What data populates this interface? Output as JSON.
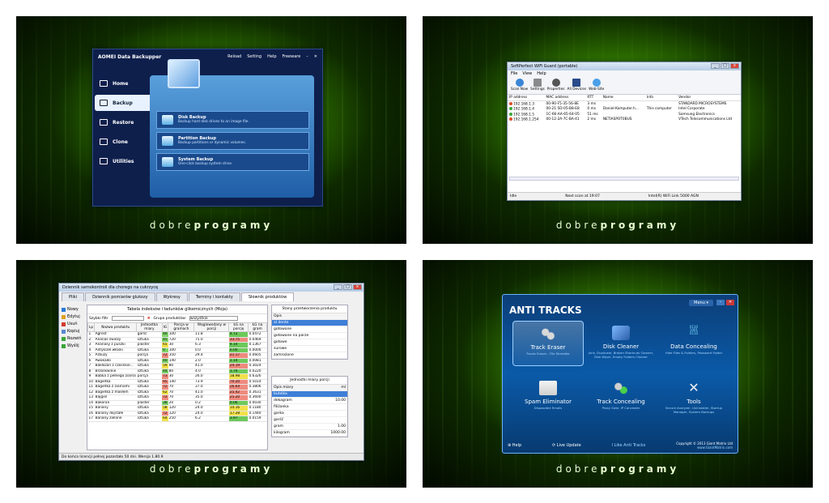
{
  "brand": {
    "prefix": "dobre",
    "suffix": "programy"
  },
  "aomei": {
    "title": "AOMEI Data Backupper",
    "toolbar": [
      "Reload",
      "Setting",
      "Help",
      "Freeware"
    ],
    "nav": [
      "Home",
      "Backup",
      "Restore",
      "Clone",
      "Utilities"
    ],
    "options": [
      {
        "title": "Disk Backup",
        "desc": "Backup hard disk drives to an image file."
      },
      {
        "title": "Partition Backup",
        "desc": "Backup partitions or dynamic volumes."
      },
      {
        "title": "System Backup",
        "desc": "One-click backup system drive."
      }
    ]
  },
  "wifi": {
    "title": "SoftPerfect WiFi Guard (portable)",
    "menu": [
      "File",
      "View",
      "Help"
    ],
    "tools": [
      "Scan Now",
      "Settings",
      "Properties",
      "All Devices",
      "Web-Site"
    ],
    "columns": [
      "IP address",
      "MAC address",
      "RTT",
      "Name",
      "Info",
      "Vendor"
    ],
    "rows": [
      {
        "ip": "192.168.1.3",
        "mac": "00-90-F5-35-56-8E",
        "rtt": "3 ms",
        "name": "",
        "info": "",
        "vendor": "STANDARD MICROSYSTEMS",
        "color": "#e24a2a"
      },
      {
        "ip": "192.168.1.4",
        "mac": "00-21-5D-05-B8-E8",
        "rtt": "0 ms",
        "name": "Daniel-Komputer.h...",
        "info": "This computer",
        "vendor": "Intel Corporate",
        "color": "#3aa53a"
      },
      {
        "ip": "192.168.1.5",
        "mac": "1C-66-AA-65-64-05",
        "rtt": "51 ms",
        "name": "",
        "info": "",
        "vendor": "Samsung Electronics",
        "color": "#3aa53a"
      },
      {
        "ip": "192.168.1.254",
        "mac": "00-12-2A-7C-BA-41",
        "rtt": "2 ms",
        "name": "NETIASPOT0BUS",
        "info": "",
        "vendor": "VTech Telecommunications Ltd",
        "color": "#e24a2a"
      }
    ],
    "status": [
      "Idle",
      "Next scan at 19:07",
      "Intel(R) WiFi Link 5000 AGN"
    ]
  },
  "gi": {
    "title": "Dziennik samokontroli dla chorego na cukrzycę",
    "tabs": [
      "Pliki",
      "Dziennik pomiarów glukozy",
      "Wykresy",
      "Terminy i kontakty",
      "Słownik produktów"
    ],
    "side": [
      "Nowy",
      "Edytuj",
      "Usuń",
      "Kopiuj",
      "Rozwiń",
      "Wyślij"
    ],
    "header": "Tabela indeksów i ładunków glikemicznych (Moja)",
    "filter_label": "Szybki filtr",
    "group_label": "Grupa produktów:",
    "group_value": "wszystkie",
    "columns": [
      "Nazwa produktu",
      "Jednostka miary",
      "IG",
      "Porcja w gramach",
      "Węglowodany w porcji",
      "ŁG na porcję",
      "ŁG na gram"
    ],
    "rows": [
      [
        "1",
        "Agrest",
        "garść",
        "40",
        "100",
        "11.8",
        "0.1180",
        "4.72",
        "0.0472"
      ],
      [
        "2",
        "Ananas świeży",
        "sztuka",
        "45",
        "720",
        "75.0",
        "0.1042",
        "33.75",
        "0.0469"
      ],
      [
        "3",
        "Ananasy z puszki",
        "plaster",
        "65",
        "30",
        "6.3",
        "0.2100",
        "4.10",
        "0.1367"
      ],
      [
        "4",
        "Antykiżel włoski",
        "sztuka",
        "0",
        "100",
        "0.0",
        "0.0000",
        "0.00",
        "0.0000"
      ],
      [
        "5",
        "Arbuzy",
        "porcja",
        "72",
        "350",
        "29.4",
        "0.0840",
        "21.17",
        "0.0605"
      ],
      [
        "6",
        "Awokado",
        "sztuka",
        "40",
        "140",
        "2.0",
        "0.0143",
        "1.14",
        "0.0081"
      ],
      [
        "7",
        "Bakłażan z czosnkie...",
        "sztuka",
        "59",
        "80",
        "41.0",
        "0.5125",
        "24.19",
        "0.3024"
      ],
      [
        "8",
        "Brzoskwinie",
        "sztuka",
        "44",
        "80",
        "4.0",
        "0.0500",
        "1.76",
        "0.0220"
      ],
      [
        "9",
        "Babka z pełnego ziarna",
        "porcja",
        "73",
        "30",
        "26.0",
        "0.8667",
        "18.98",
        "0.6326"
      ],
      [
        "10",
        "Bagietka",
        "sztuka",
        "95",
        "140",
        "73.9",
        "0.5279",
        "70.20",
        "0.5014"
      ],
      [
        "11",
        "Bagietka z ziarnami",
        "sztuka",
        "72",
        "70",
        "37.0",
        "0.5286",
        "26.64",
        "0.3806"
      ],
      [
        "12",
        "Bagietka z masłem",
        "sztuka",
        "62",
        "70",
        "41.0",
        "0.5857",
        "25.42",
        "0.3631"
      ],
      [
        "13",
        "Bajgiel",
        "sztuka",
        "72",
        "70",
        "35.0",
        "0.5000",
        "25.20",
        "0.3600"
      ],
      [
        "14",
        "Bakoran",
        "plaster",
        "38",
        "20",
        "0.2",
        "0.0060",
        "0.06",
        "0.0030"
      ],
      [
        "15",
        "Banany",
        "sztuka",
        "58",
        "120",
        "24.0",
        "0.2000",
        "14.16",
        "0.1180"
      ],
      [
        "16",
        "Banany dojrzałe",
        "sztuka",
        "72",
        "120",
        "24.0",
        "0.2000",
        "17.28",
        "0.1440"
      ],
      [
        "17",
        "Banany zielone",
        "sztuka",
        "64",
        "250",
        "6.2",
        "0.0248",
        "3.97",
        "0.0159"
      ]
    ],
    "prep_title": "Stany przetworzenia produktu",
    "prep_col": "Opis",
    "prep": [
      "al dente",
      "gotowane",
      "gotowane na parze",
      "gotowe",
      "surowe",
      "zamrożone"
    ],
    "units_title": "Jednostki miary porcji",
    "units_cols": [
      "Opis miary",
      "ml"
    ],
    "units": [
      [
        "butelka",
        ""
      ],
      [
        "dekagram",
        "10.00"
      ],
      [
        "filiżanka",
        ""
      ],
      [
        "garka",
        ""
      ],
      [
        "garść",
        ""
      ],
      [
        "gram",
        "1.00"
      ],
      [
        "kilogram",
        "1000.00"
      ]
    ],
    "status": "Do końca licencji pełnej pozostało 50 dni.   Wersja 1.80.9"
  },
  "at": {
    "title": "ANTI TRACKS",
    "menu": "Menu ▾",
    "tiles": [
      {
        "name": "Track Eraser",
        "desc": "Tracks Eraser - File Shredder"
      },
      {
        "name": "Disk Cleaner",
        "desc": "Junk, Duplicate, Broken Shortcuts Cleaner, Disk Wiper, Empty Folders Cleaner"
      },
      {
        "name": "Data Concealing",
        "desc": "Hide Files & Folders, Password Folder"
      },
      {
        "name": "Spam Eliminator",
        "desc": "Disposable Emails"
      },
      {
        "name": "Track Concealing",
        "desc": "Proxy Gate, IP Concealer"
      },
      {
        "name": "Tools",
        "desc": "Secure Analyzer, Uninstaller, Startup Manager, System Backups"
      }
    ],
    "help": "Help",
    "update": "Live Update",
    "like": "I Like Anti Tracks",
    "copy": "Copyright © 2013 Giant Matrix Ltd",
    "site": "www.GiantMatrix.com"
  }
}
